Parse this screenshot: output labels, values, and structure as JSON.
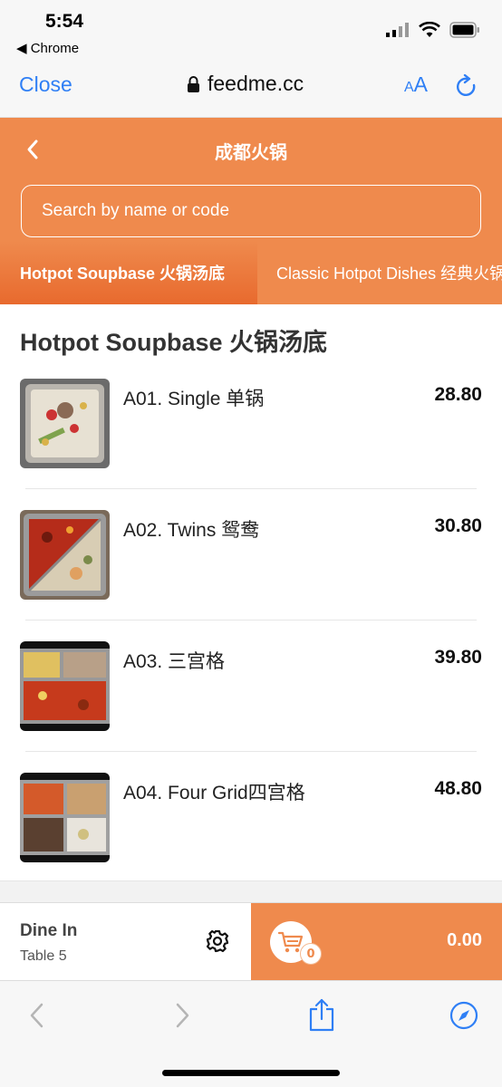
{
  "status": {
    "time": "5:54",
    "back_app": "◀ Chrome"
  },
  "browser": {
    "close_label": "Close",
    "url": "feedme.cc",
    "text_size_small": "A",
    "text_size_big": "A"
  },
  "header": {
    "title": "成都火锅",
    "search_placeholder": "Search by name or code"
  },
  "tabs": [
    {
      "label": "Hotpot Soupbase 火锅汤底",
      "active": true
    },
    {
      "label": "Classic Hotpot Dishes 经典火锅菜",
      "active": false
    }
  ],
  "section_title": "Hotpot Soupbase 火锅汤底",
  "items": [
    {
      "name": "A01. Single 单锅",
      "price": "28.80"
    },
    {
      "name": "A02. Twins 鸳鸯",
      "price": "30.80"
    },
    {
      "name": "A03. 三宫格",
      "price": "39.80"
    },
    {
      "name": "A04. Four Grid四宫格",
      "price": "48.80"
    }
  ],
  "bottom": {
    "mode": "Dine In",
    "table": "Table 5",
    "cart_count": "0",
    "total": "0.00"
  },
  "colors": {
    "accent": "#ef8a4d",
    "link": "#2f7ff5"
  }
}
